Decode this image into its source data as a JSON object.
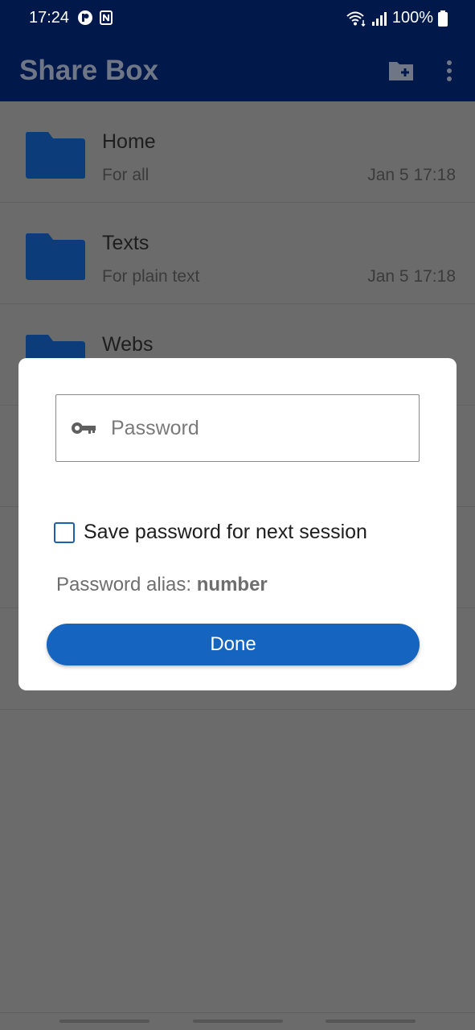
{
  "status_bar": {
    "time": "17:24",
    "battery": "100%",
    "icons": [
      "app-notification-icon",
      "sim-icon",
      "wifi-icon",
      "signal-icon",
      "battery-icon"
    ]
  },
  "app_bar": {
    "title": "Share Box",
    "actions": [
      "new-folder-icon",
      "more-vert-icon"
    ]
  },
  "list": {
    "items": [
      {
        "name": "Home",
        "description": "For all",
        "date": "Jan 5 17:18"
      },
      {
        "name": "Texts",
        "description": "For plain text",
        "date": "Jan 5 17:18"
      },
      {
        "name": "Webs",
        "description": "",
        "date": ""
      }
    ]
  },
  "dialog": {
    "password_placeholder": "Password",
    "save_checkbox_label": "Save password for next session",
    "save_checked": false,
    "alias_label": "Password alias:",
    "alias_value": "number",
    "done_label": "Done"
  },
  "colors": {
    "app_bar": "#00184a",
    "accent": "#1565c0",
    "folder": "#0d3c7a",
    "scrim": "#6b6b6b"
  }
}
